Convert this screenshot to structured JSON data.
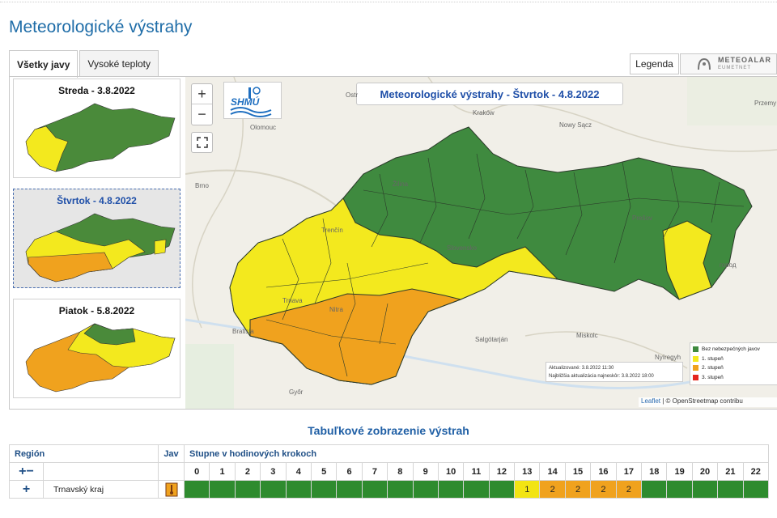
{
  "page": {
    "title": "Meteorologické výstrahy"
  },
  "tabs": [
    {
      "label": "Všetky javy"
    },
    {
      "label": "Vysoké teploty"
    }
  ],
  "toolbar": {
    "legend_label": "Legenda",
    "meteoalarm_title": "METEOALAR",
    "meteoalarm_sub": "EUMETNET"
  },
  "days": [
    {
      "label": "Streda - 3.8.2022"
    },
    {
      "label": "Štvrtok - 4.8.2022"
    },
    {
      "label": "Piatok - 5.8.2022"
    }
  ],
  "map": {
    "title": "Meteorologické výstrahy - Štvrtok - 4.8.2022",
    "zoom_in": "+",
    "zoom_out": "−",
    "fullscreen_icon": "fullscreen-icon",
    "logo_text": "SHMÚ",
    "cities": [
      "Ostr",
      "Olomouc",
      "Nowy Sącz",
      "Przemy",
      "Brno",
      "Žilina",
      "Kraków",
      "Prešov",
      "Trenčín",
      "Slovensko",
      "Trnava",
      "Nitra",
      "Salgótarján",
      "Miskolc",
      "Bratisla",
      "Győr",
      "Nyíregyh",
      "город"
    ],
    "updated": "Aktualizované: 3.8.2022 11:30",
    "next_update": "Najbližšia aktualizácia najneskôr: 3.8.2022 18:00",
    "legend": [
      {
        "label": "Bez nebezpečných javov",
        "color": "#3f8a3f"
      },
      {
        "label": "1. stupeň",
        "color": "#f3e91e"
      },
      {
        "label": "2. stupeň",
        "color": "#f0a21e"
      },
      {
        "label": "3. stupeň",
        "color": "#e5261d"
      }
    ],
    "attribution_leaflet": "Leaflet",
    "attribution_rest": " | © OpenStreetmap contribu"
  },
  "table": {
    "title": "Tabuľkové zobrazenie výstrah",
    "col_region": "Región",
    "col_jav": "Jav",
    "col_steps": "Stupne v hodinových krokoch",
    "expand_all": "+−",
    "hours": [
      "0",
      "1",
      "2",
      "3",
      "4",
      "5",
      "6",
      "7",
      "8",
      "9",
      "10",
      "11",
      "12",
      "13",
      "14",
      "15",
      "16",
      "17",
      "18",
      "19",
      "20",
      "21",
      "22"
    ],
    "rows": [
      {
        "expand": "+",
        "region": "Trnavský kraj",
        "jav_icon": "thermometer-icon",
        "levels": [
          "",
          "",
          "",
          "",
          "",
          "",
          "",
          "",
          "",
          "",
          "",
          "",
          "",
          "1",
          "2",
          "2",
          "2",
          "2",
          "",
          "",
          "",
          "",
          ""
        ]
      }
    ]
  }
}
